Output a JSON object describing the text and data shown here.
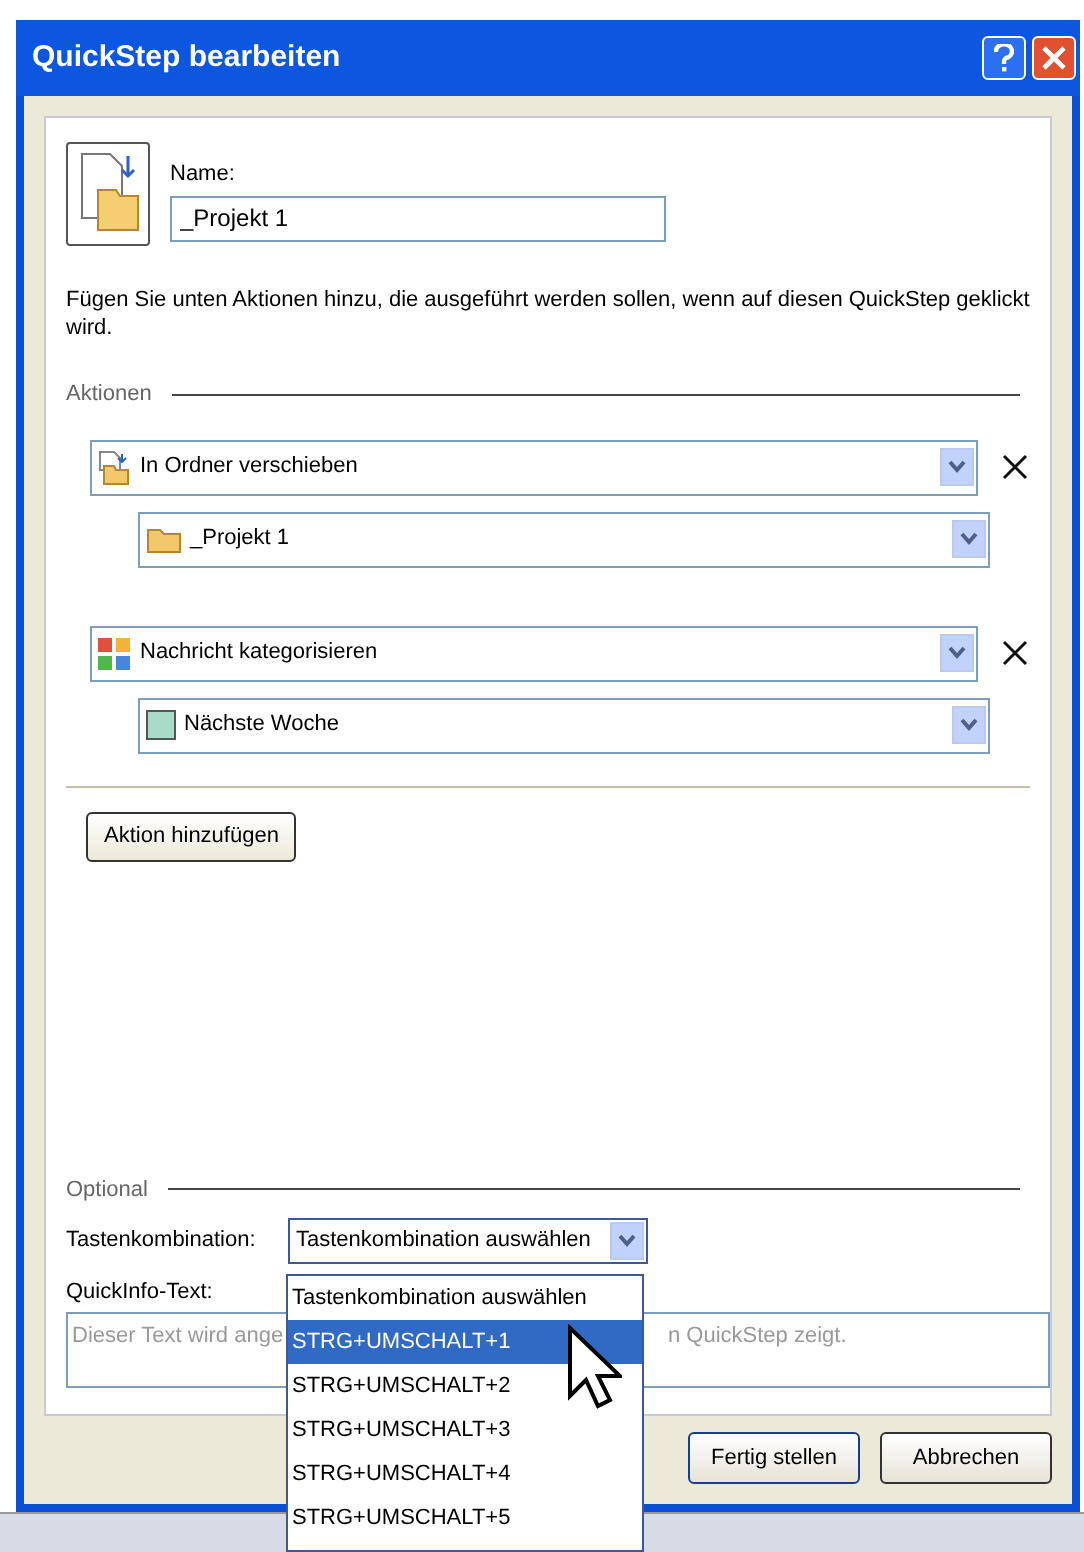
{
  "window": {
    "title": "QuickStep bearbeiten"
  },
  "name_field": {
    "label": "Name:",
    "value": "_Projekt 1"
  },
  "instructions": "Fügen Sie unten Aktionen hinzu, die ausgeführt werden sollen, wenn auf diesen QuickStep geklickt wird.",
  "actions_heading": "Aktionen",
  "actions": [
    {
      "kind": "move",
      "value": "In Ordner verschieben",
      "option": {
        "kind": "folder",
        "value": "_Projekt 1"
      }
    },
    {
      "kind": "categorize",
      "value": "Nachricht kategorisieren",
      "option": {
        "kind": "category",
        "value": "Nächste Woche",
        "color": "#a8dcc8"
      }
    }
  ],
  "add_action_button": "Aktion hinzufügen",
  "optional_heading": "Optional",
  "shortcut": {
    "label": "Tastenkombination:",
    "value": "Tastenkombination auswählen",
    "expanded": true,
    "options": [
      {
        "label": "Tastenkombination auswählen",
        "highlighted": false
      },
      {
        "label": "STRG+UMSCHALT+1",
        "highlighted": true
      },
      {
        "label": "STRG+UMSCHALT+2",
        "highlighted": false
      },
      {
        "label": "STRG+UMSCHALT+3",
        "highlighted": false
      },
      {
        "label": "STRG+UMSCHALT+4",
        "highlighted": false
      },
      {
        "label": "STRG+UMSCHALT+5",
        "highlighted": false
      }
    ]
  },
  "tooltip_text": {
    "label": "QuickInfo-Text:",
    "placeholder_visible": [
      "Dieser Text wird ange",
      "n QuickStep zeigt."
    ]
  },
  "buttons": [
    "Fertig stellen",
    "Abbrechen"
  ]
}
